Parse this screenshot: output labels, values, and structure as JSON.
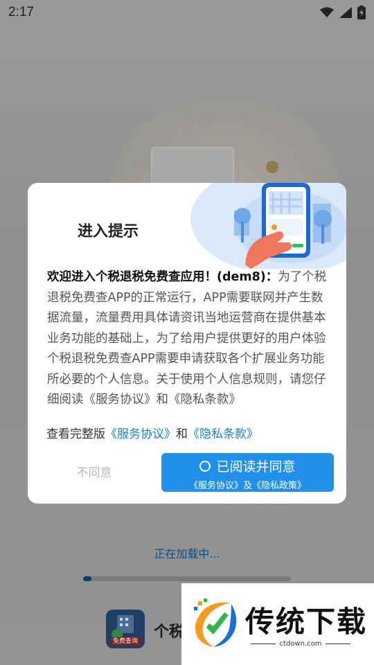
{
  "status_bar": {
    "time": "2:17",
    "icons": [
      "wifi-icon",
      "cell-signal-icon",
      "battery-charging-icon"
    ]
  },
  "dialog": {
    "title": "进入提示",
    "lead": "欢迎进入个税退税免费查应用！(dem8)：",
    "body": "为了个税退税免费查APP的正常运行，APP需要联网并产生数据流量，流量费用具体请资讯当地运营商在提供基本业务功能的基础上，为了给用户提供更好的用户体验个税退税免费查APP需要申请获取各个扩展业务功能所必要的个人信息。关于使用个人信息规则，请您仔细阅读《服务协议》和《隐私条款》",
    "links_prefix": "查看完整版",
    "service_link": "《服务协议》",
    "links_and": "和",
    "privacy_link": "《隐私条款》",
    "disagree_label": "不同意",
    "agree_label": "已阅读并同意",
    "agree_sub": "《服务协议》及《隐私政策》"
  },
  "loading": {
    "text": "正在加载中...",
    "progress": 0.04
  },
  "app": {
    "logo_tag": "免费查询",
    "name": "个税"
  },
  "watermark": {
    "brand": "传统下载",
    "url": "ctdown.com"
  },
  "colors": {
    "accent": "#2090ea",
    "link": "#1a7fd6",
    "progress": "#0d3d6b"
  }
}
